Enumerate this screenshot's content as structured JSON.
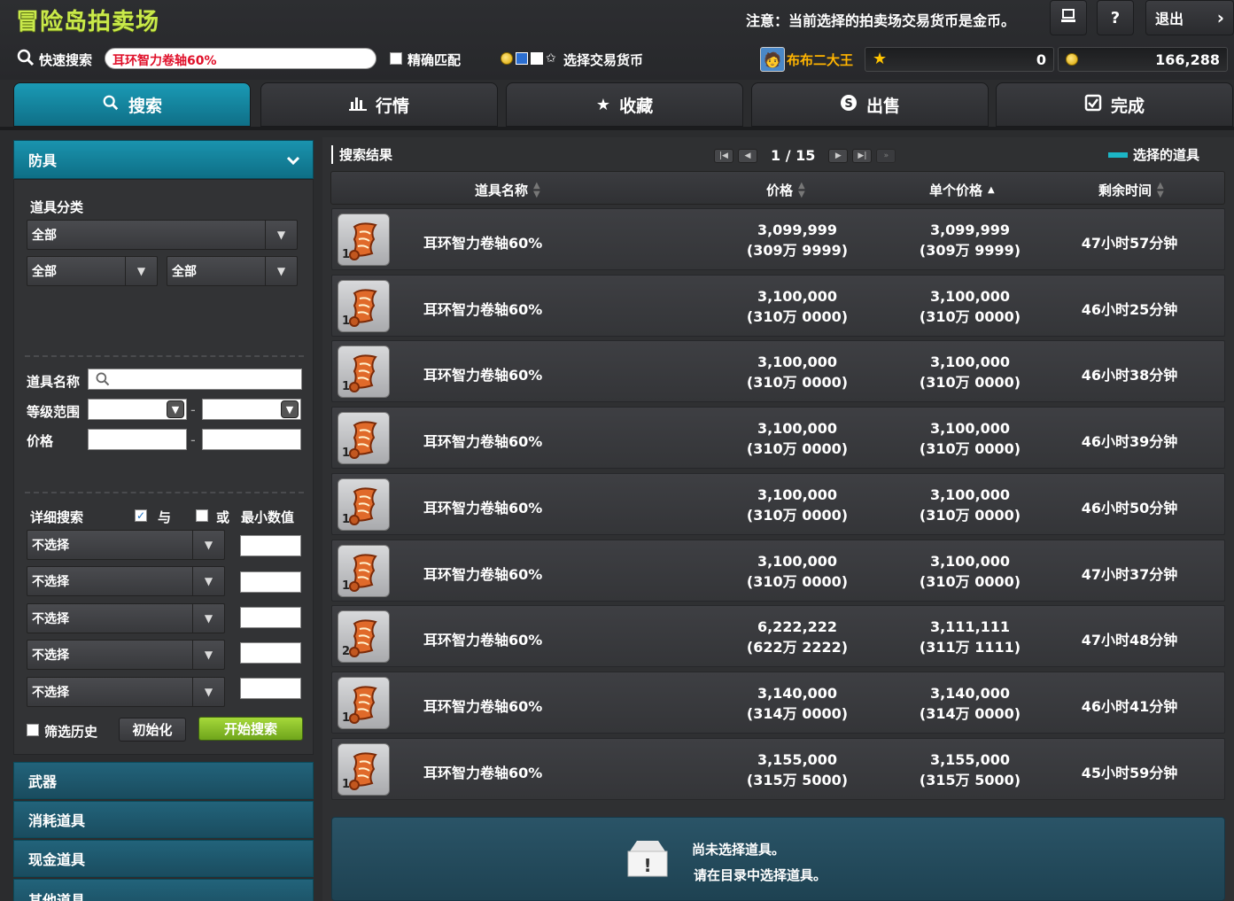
{
  "app": {
    "title": "冒险岛拍卖场",
    "notice": "注意：当前选择的拍卖场交易货币是金币。",
    "buttons": {
      "help": "?",
      "exit": "退出",
      "next": "›"
    }
  },
  "quick_search": {
    "label": "快速搜索",
    "value": "耳环智力卷轴60%",
    "exact_match_label": "精确匹配",
    "exact_match_checked": false,
    "currency_label": "选择交易货币"
  },
  "character": {
    "name": "布布二大王",
    "star_balance": "0",
    "meso_balance": "166,288"
  },
  "tabs": [
    {
      "label": "搜索",
      "icon": "search-icon",
      "active": true
    },
    {
      "label": "行情",
      "icon": "chart-icon",
      "active": false
    },
    {
      "label": "收藏",
      "icon": "star-icon",
      "active": false
    },
    {
      "label": "出售",
      "icon": "dollar-icon",
      "active": false
    },
    {
      "label": "完成",
      "icon": "check-icon",
      "active": false
    }
  ],
  "sidebar": {
    "category": "防具",
    "item_class_label": "道具分类",
    "class_select": "全部",
    "sub_select_1": "全部",
    "sub_select_2": "全部",
    "item_name_label": "道具名称",
    "level_range_label": "等级范围",
    "level_sep": "-",
    "price_label": "价格",
    "price_sep": "-",
    "detail_search_label": "详细搜索",
    "and_label": "与",
    "or_label": "或",
    "min_value_label": "最小数值",
    "detail_rows": [
      "不选择",
      "不选择",
      "不选择",
      "不选择",
      "不选择"
    ],
    "history_label": "筛选历史",
    "reset_label": "初始化",
    "start_label": "开始搜索",
    "other_categories": [
      "武器",
      "消耗道具",
      "现金道具",
      "其他道具"
    ]
  },
  "results": {
    "title": "搜索结果",
    "page": "1 / 15",
    "legend": "选择的道具",
    "columns": {
      "name": "道具名称",
      "price": "价格",
      "unit_price": "单个价格",
      "time": "剩余时间"
    },
    "rows": [
      {
        "name": "耳环智力卷轴60%",
        "qty": "1",
        "price": "3,099,999",
        "price_cn": "(309万 9999)",
        "unit": "3,099,999",
        "unit_cn": "(309万 9999)",
        "time": "47小时57分钟"
      },
      {
        "name": "耳环智力卷轴60%",
        "qty": "1",
        "price": "3,100,000",
        "price_cn": "(310万 0000)",
        "unit": "3,100,000",
        "unit_cn": "(310万 0000)",
        "time": "46小时25分钟"
      },
      {
        "name": "耳环智力卷轴60%",
        "qty": "1",
        "price": "3,100,000",
        "price_cn": "(310万 0000)",
        "unit": "3,100,000",
        "unit_cn": "(310万 0000)",
        "time": "46小时38分钟"
      },
      {
        "name": "耳环智力卷轴60%",
        "qty": "1",
        "price": "3,100,000",
        "price_cn": "(310万 0000)",
        "unit": "3,100,000",
        "unit_cn": "(310万 0000)",
        "time": "46小时39分钟"
      },
      {
        "name": "耳环智力卷轴60%",
        "qty": "1",
        "price": "3,100,000",
        "price_cn": "(310万 0000)",
        "unit": "3,100,000",
        "unit_cn": "(310万 0000)",
        "time": "46小时50分钟"
      },
      {
        "name": "耳环智力卷轴60%",
        "qty": "1",
        "price": "3,100,000",
        "price_cn": "(310万 0000)",
        "unit": "3,100,000",
        "unit_cn": "(310万 0000)",
        "time": "47小时37分钟"
      },
      {
        "name": "耳环智力卷轴60%",
        "qty": "2",
        "price": "6,222,222",
        "price_cn": "(622万 2222)",
        "unit": "3,111,111",
        "unit_cn": "(311万 1111)",
        "time": "47小时48分钟"
      },
      {
        "name": "耳环智力卷轴60%",
        "qty": "1",
        "price": "3,140,000",
        "price_cn": "(314万 0000)",
        "unit": "3,140,000",
        "unit_cn": "(314万 0000)",
        "time": "46小时41分钟"
      },
      {
        "name": "耳环智力卷轴60%",
        "qty": "1",
        "price": "3,155,000",
        "price_cn": "(315万 5000)",
        "unit": "3,155,000",
        "unit_cn": "(315万 5000)",
        "time": "45小时59分钟"
      }
    ],
    "empty_line1": "尚未选择道具。",
    "empty_line2": "请在目录中选择道具。"
  }
}
